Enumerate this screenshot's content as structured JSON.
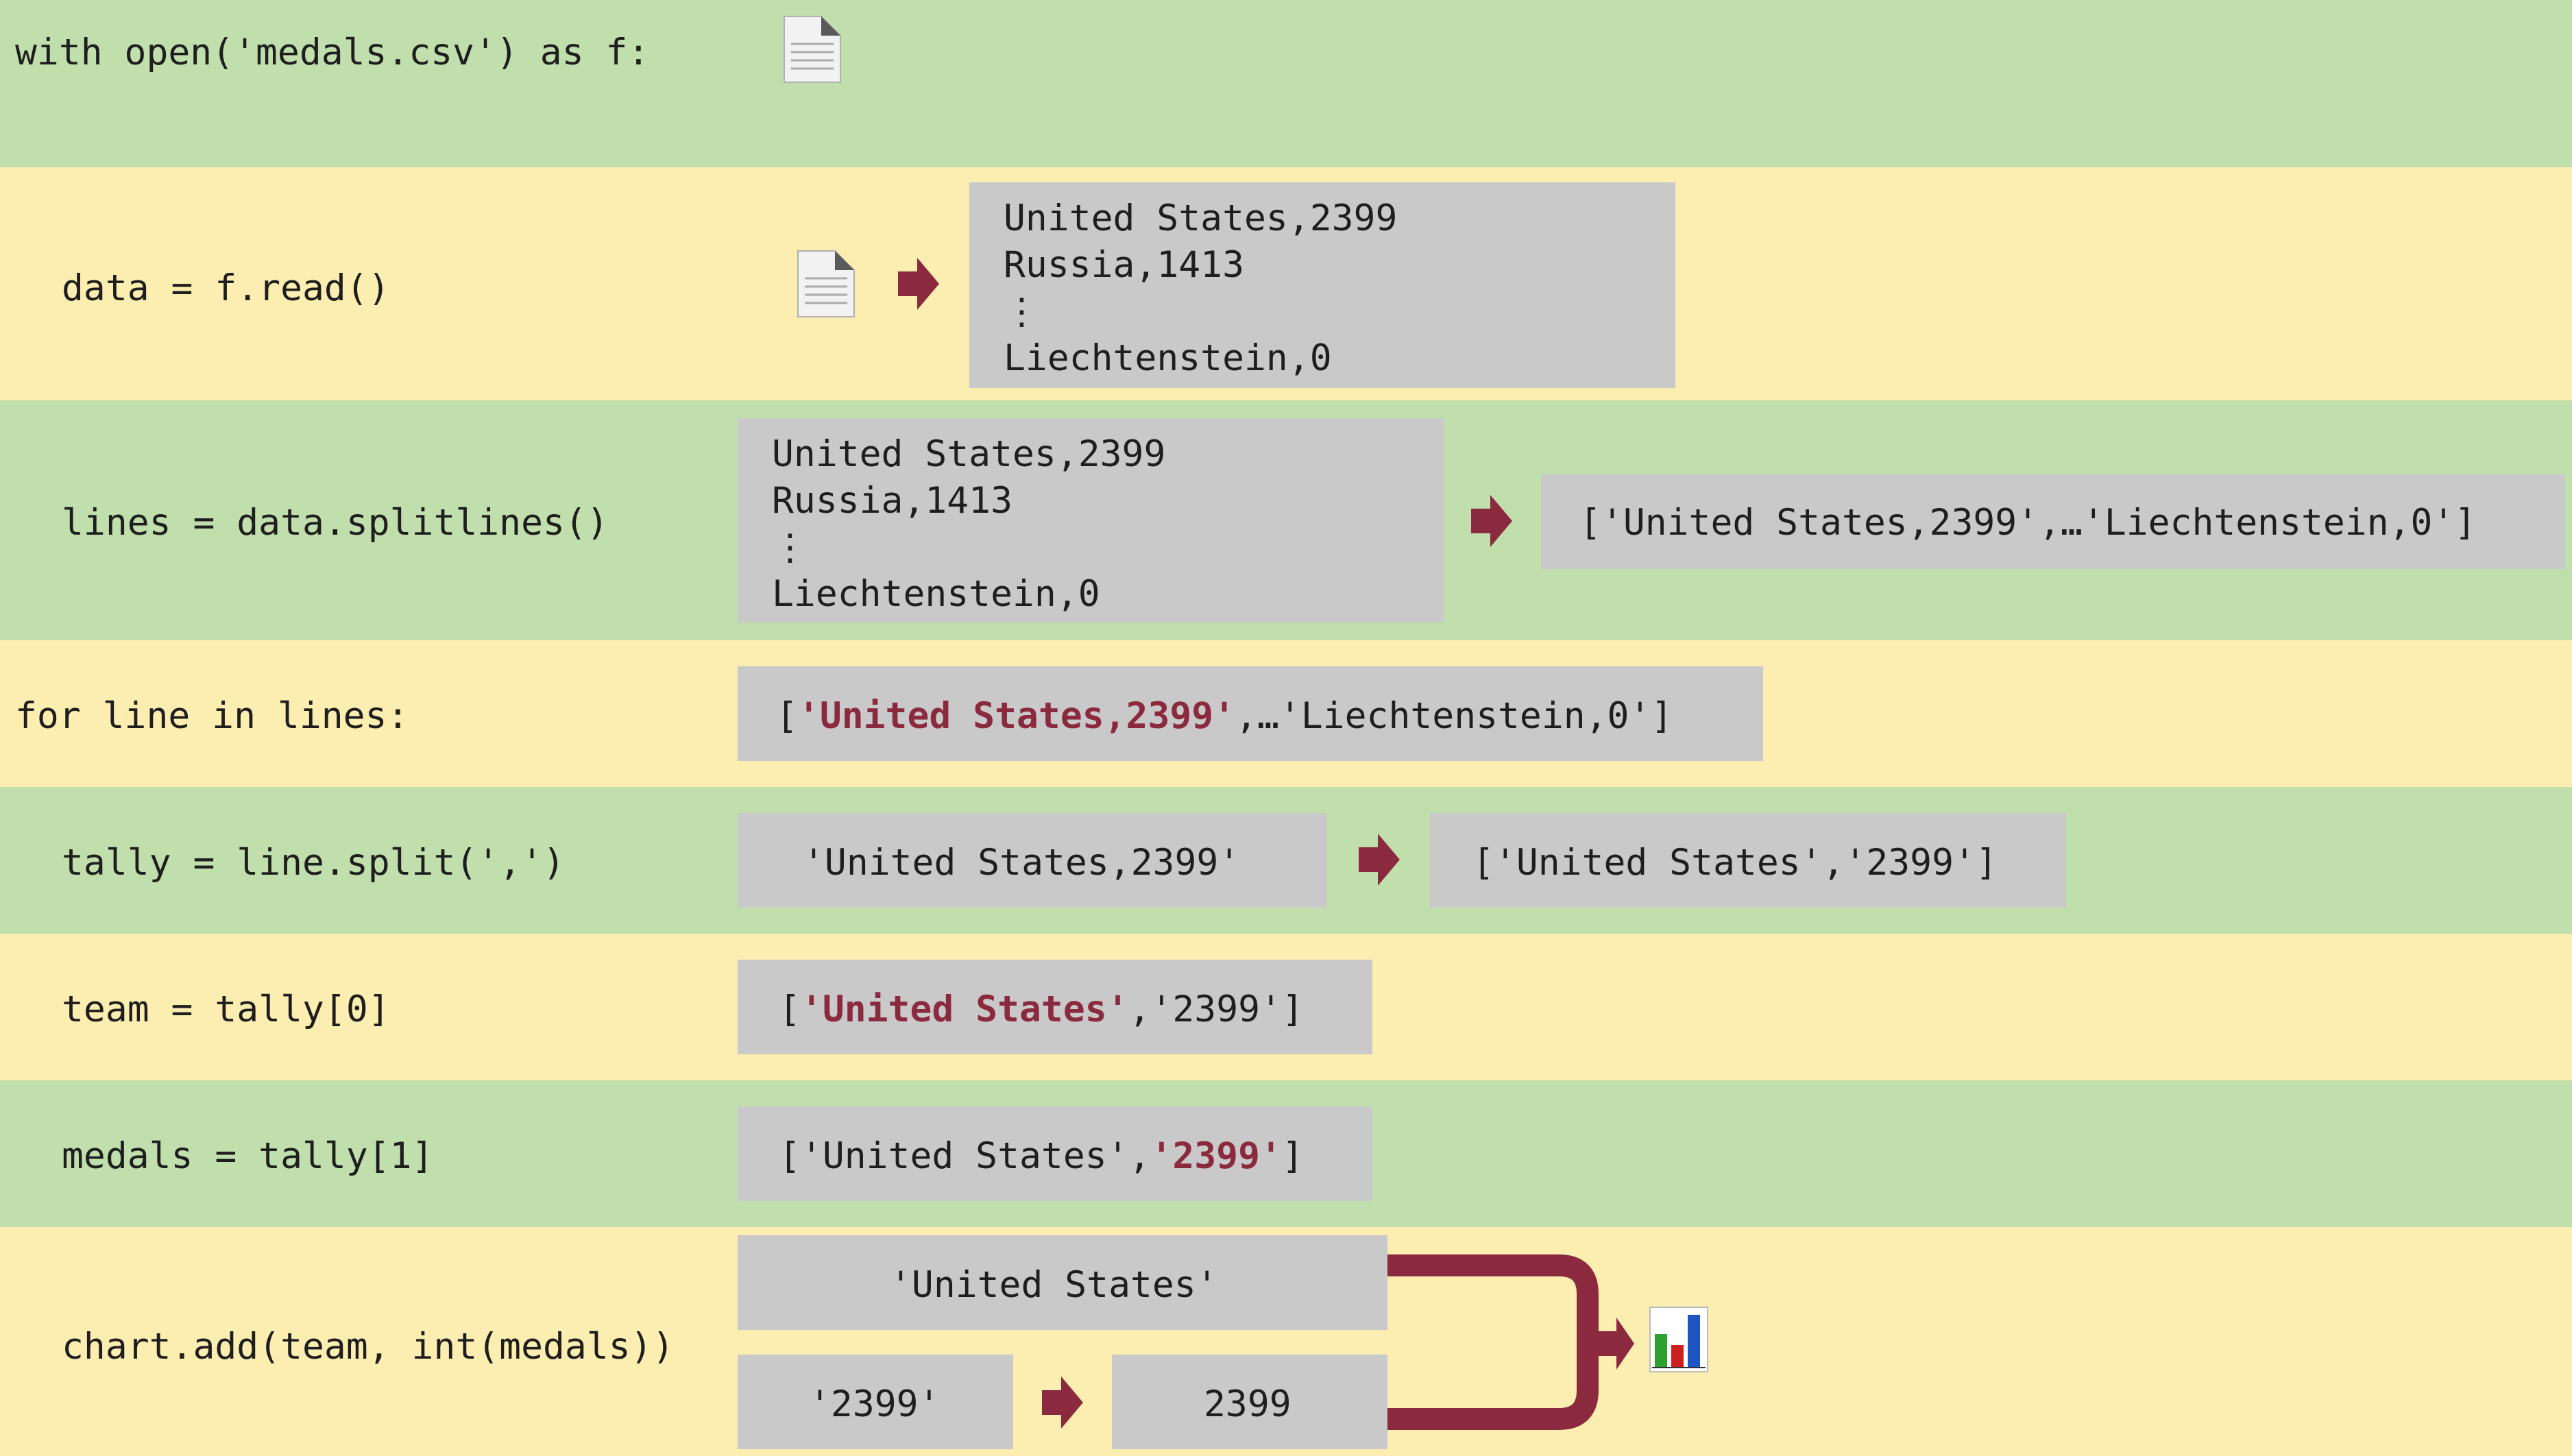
{
  "colors": {
    "green_band": "#c0dfac",
    "yellow_band": "#fcedb0",
    "box": "#c9c9c9",
    "accent": "#8b2a3f"
  },
  "rows": {
    "open": {
      "code": "with open('medals.csv') as f:"
    },
    "read": {
      "code": "data = f.read()",
      "file_lines": [
        "United States,2399",
        "Russia,1413",
        "⋮",
        "Liechtenstein,0"
      ]
    },
    "splitlines": {
      "code": "lines = data.splitlines()",
      "input_lines": [
        "United States,2399",
        "Russia,1413",
        "⋮",
        "Liechtenstein,0"
      ],
      "output": "['United States,2399',…'Liechtenstein,0']"
    },
    "loop": {
      "code": "for line in lines:",
      "list_open": "[",
      "list_highlight": "'United States,2399'",
      "list_rest": ",…'Liechtenstein,0']"
    },
    "split": {
      "code": "tally = line.split(',')",
      "input": "'United States,2399'",
      "output": "['United States','2399']"
    },
    "team": {
      "code": "team = tally[0]",
      "open": "[",
      "highlight": "'United States'",
      "rest": ",'2399']"
    },
    "medals": {
      "code": "medals = tally[1]",
      "before": "['United States',",
      "highlight": "'2399'",
      "close": "]"
    },
    "chart": {
      "code": "chart.add(team, int(medals))",
      "team_value": "'United States'",
      "medals_string": "'2399'",
      "medals_int": "2399"
    }
  },
  "icons": {
    "file": "document-icon",
    "arrow": "right-arrow-icon",
    "chart": "bar-chart-icon"
  }
}
